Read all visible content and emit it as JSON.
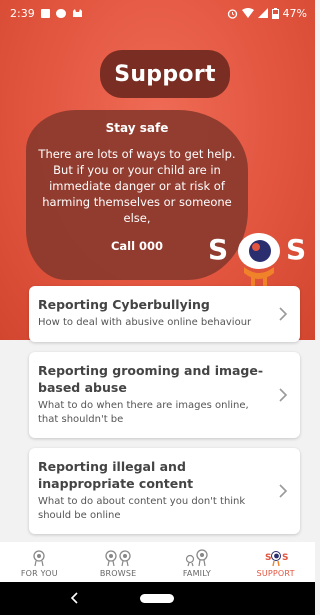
{
  "status_bar": {
    "time": "2:39",
    "battery": "47%"
  },
  "header": {
    "title": "Support"
  },
  "info": {
    "heading": "Stay safe",
    "body": "There are lots of ways to get help. But if you or your child are in immediate danger or at risk of harming themselves or someone else,",
    "call": "Call 000"
  },
  "logo": {
    "text": "SOS"
  },
  "cards": [
    {
      "title": "Reporting Cyberbullying",
      "description": "How to deal with abusive online behaviour"
    },
    {
      "title": "Reporting grooming and image-based abuse",
      "description": "What to do when there are images online, that shouldn't be"
    },
    {
      "title": "Reporting illegal and inappropriate content",
      "description": "What to do about content you don't think should be online"
    }
  ],
  "bottom_nav": {
    "items": [
      {
        "label": "FOR YOU",
        "icon": "single-eye-character-icon"
      },
      {
        "label": "BROWSE",
        "icon": "double-eye-characters-icon"
      },
      {
        "label": "FAMILY",
        "icon": "family-characters-icon"
      },
      {
        "label": "SUPPORT",
        "icon": "sos-icon",
        "active": true
      }
    ]
  },
  "colors": {
    "accent": "#e2553f",
    "title_pill": "#7a2d22",
    "info_blob": "#8a3a2e",
    "mascot_orange": "#f0822a"
  }
}
